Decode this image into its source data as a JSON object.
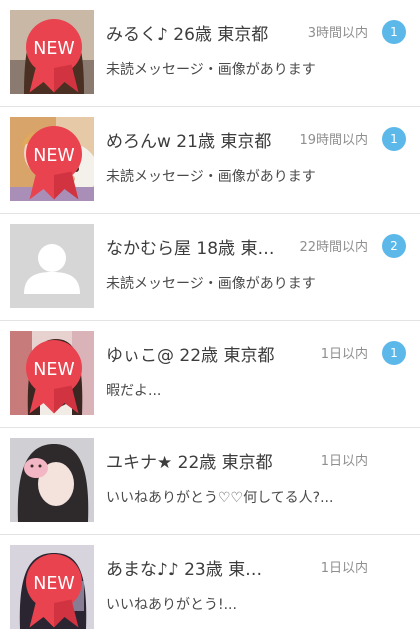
{
  "messages": [
    {
      "name": "みるく♪ 26歳 東京都",
      "time": "3時間以内",
      "preview": "未読メッセージ・画像があります",
      "unread": "1",
      "is_new": true,
      "avatar": "photo-girl-brown-hair"
    },
    {
      "name": "めろんw 21歳 東京都",
      "time": "19時間以内",
      "preview": "未読メッセージ・画像があります",
      "unread": "1",
      "is_new": true,
      "avatar": "photo-girl-with-bear-plush"
    },
    {
      "name": "なかむら屋 18歳 東…",
      "time": "22時間以内",
      "preview": "未読メッセージ・画像があります",
      "unread": "2",
      "is_new": false,
      "avatar": "default-silhouette"
    },
    {
      "name": "ゆぃこ@ 22歳 東京都",
      "time": "1日以内",
      "preview": "暇だよ...",
      "unread": "1",
      "is_new": true,
      "avatar": "photo-girl-bangs"
    },
    {
      "name": "ユキナ★ 22歳 東京都",
      "time": "1日以内",
      "preview": "いいねありがとう♡♡何してる人?...",
      "unread": "",
      "is_new": false,
      "avatar": "photo-girl-cat-sticker"
    },
    {
      "name": "あまな♪♪ 23歳 東…",
      "time": "1日以内",
      "preview": "いいねありがとう!...",
      "unread": "",
      "is_new": true,
      "avatar": "photo-girl-dark-hair"
    }
  ],
  "badge_label": "NEW",
  "colors": {
    "unread_badge": "#5db8ea",
    "new_ribbon": "#e8434f",
    "divider": "#e3e3e3"
  }
}
